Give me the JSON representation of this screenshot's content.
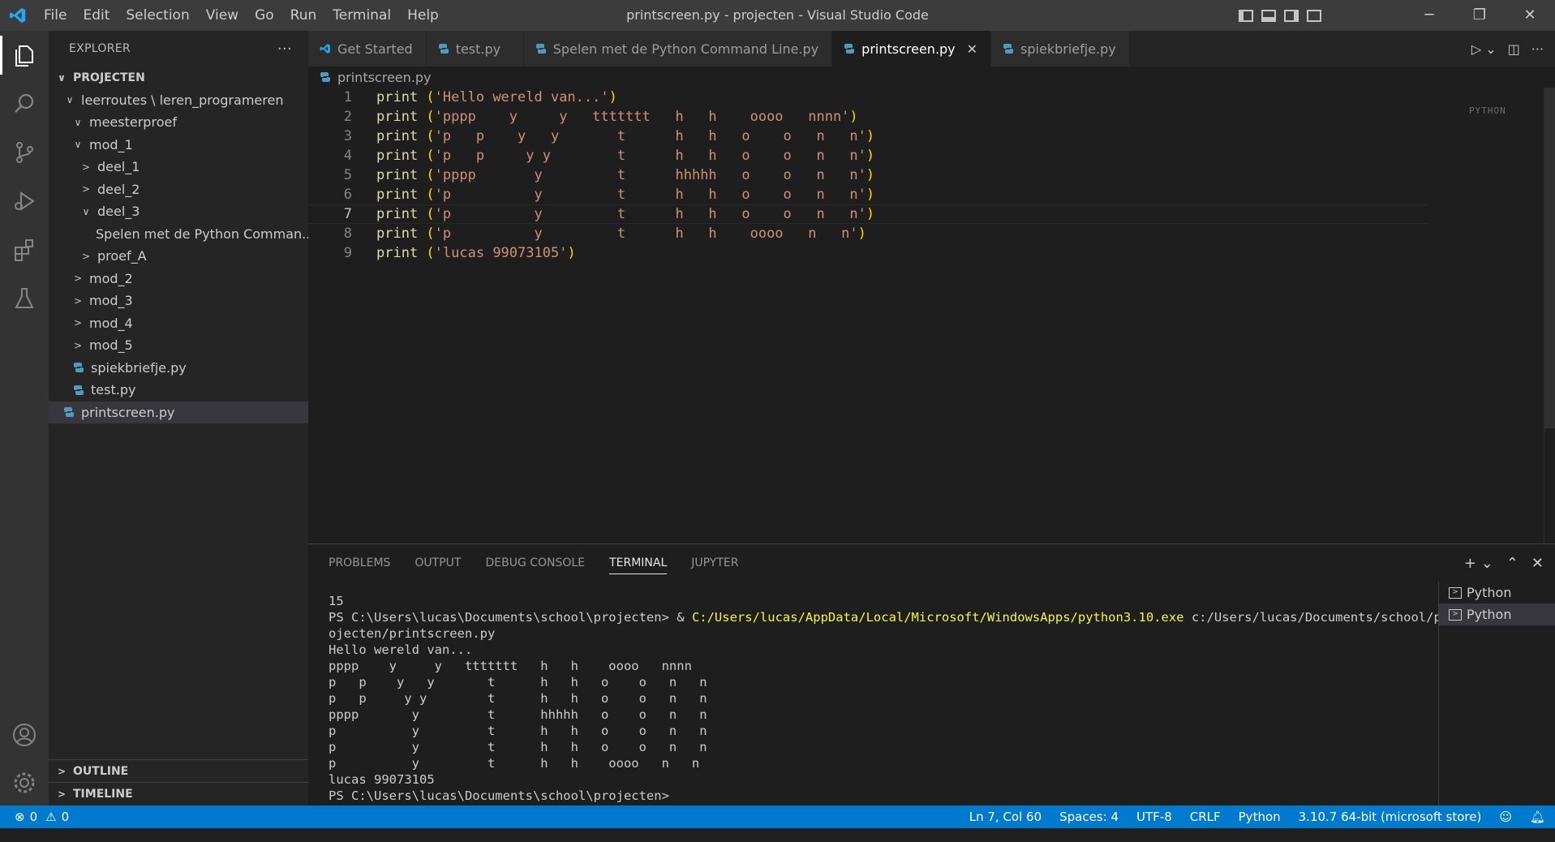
{
  "window": {
    "title": "printscreen.py - projecten - Visual Studio Code",
    "menu": [
      "File",
      "Edit",
      "Selection",
      "View",
      "Go",
      "Run",
      "Terminal",
      "Help"
    ]
  },
  "activitybar": {
    "icons": [
      "explorer-icon",
      "search-icon",
      "source-control-icon",
      "run-debug-icon",
      "extensions-icon",
      "testing-icon",
      "account-icon",
      "settings-gear-icon"
    ]
  },
  "sidebar": {
    "title": "EXPLORER",
    "more": "···",
    "tree": [
      {
        "label": "PROJECTEN",
        "chev": "∨",
        "depth": 0,
        "kind": "section"
      },
      {
        "label": "leerroutes \\ leren_programeren",
        "chev": "∨",
        "depth": 1,
        "kind": "folder"
      },
      {
        "label": "meesterproef",
        "chev": "∨",
        "depth": 2,
        "kind": "folder"
      },
      {
        "label": "mod_1",
        "chev": "∨",
        "depth": 2,
        "kind": "folder"
      },
      {
        "label": "deel_1",
        "chev": ">",
        "depth": 3,
        "kind": "folder"
      },
      {
        "label": "deel_2",
        "chev": ">",
        "depth": 3,
        "kind": "folder"
      },
      {
        "label": "deel_3",
        "chev": "∨",
        "depth": 3,
        "kind": "folder"
      },
      {
        "label": "Spelen met de Python Comman...",
        "chev": "",
        "depth": 4,
        "kind": "py"
      },
      {
        "label": "proef_A",
        "chev": ">",
        "depth": 3,
        "kind": "folder"
      },
      {
        "label": "mod_2",
        "chev": ">",
        "depth": 2,
        "kind": "folder"
      },
      {
        "label": "mod_3",
        "chev": ">",
        "depth": 2,
        "kind": "folder"
      },
      {
        "label": "mod_4",
        "chev": ">",
        "depth": 2,
        "kind": "folder"
      },
      {
        "label": "mod_5",
        "chev": ">",
        "depth": 2,
        "kind": "folder"
      },
      {
        "label": "spiekbriefje.py",
        "chev": "",
        "depth": 2,
        "kind": "py"
      },
      {
        "label": "test.py",
        "chev": "",
        "depth": 2,
        "kind": "py"
      },
      {
        "label": "printscreen.py",
        "chev": "",
        "depth": 1,
        "kind": "py",
        "selected": true
      }
    ],
    "outline": "OUTLINE",
    "timeline": "TIMELINE"
  },
  "tabs": [
    {
      "label": "Get Started",
      "icon": "vscode-icon",
      "active": false
    },
    {
      "label": "test.py",
      "icon": "python-icon",
      "active": false
    },
    {
      "label": "Spelen met de Python Command Line.py",
      "icon": "python-icon",
      "active": false
    },
    {
      "label": "printscreen.py",
      "icon": "python-icon",
      "active": true,
      "close": "✕"
    },
    {
      "label": "spiekbriefje.py",
      "icon": "python-icon",
      "active": false
    }
  ],
  "breadcrumb": "printscreen.py",
  "editor": {
    "current_line": 7,
    "lines": [
      {
        "n": "1",
        "fn": "print",
        "open": " (",
        "str": "'Hello wereld van...'",
        "close": ")"
      },
      {
        "n": "2",
        "fn": "print",
        "open": " (",
        "str": "'pppp    y     y   ttttttt   h   h    oooo   nnnn'",
        "close": ")"
      },
      {
        "n": "3",
        "fn": "print",
        "open": " (",
        "str": "'p   p    y   y       t      h   h   o    o   n   n'",
        "close": ")"
      },
      {
        "n": "4",
        "fn": "print",
        "open": " (",
        "str": "'p   p     y y        t      h   h   o    o   n   n'",
        "close": ")"
      },
      {
        "n": "5",
        "fn": "print",
        "open": " (",
        "str": "'pppp       y         t      hhhhh   o    o   n   n'",
        "close": ")"
      },
      {
        "n": "6",
        "fn": "print",
        "open": " (",
        "str": "'p          y         t      h   h   o    o   n   n'",
        "close": ")"
      },
      {
        "n": "7",
        "fn": "print",
        "open": " (",
        "str": "'p          y         t      h   h   o    o   n   n'",
        "close": ")"
      },
      {
        "n": "8",
        "fn": "print",
        "open": " (",
        "str": "'p          y         t      h   h    oooo   n   n'",
        "close": ")"
      },
      {
        "n": "9",
        "fn": "print",
        "open": " (",
        "str": "'lucas 99073105'",
        "close": ")"
      }
    ],
    "minimap_text": "PYTHON"
  },
  "panel": {
    "tabs": [
      "PROBLEMS",
      "OUTPUT",
      "DEBUG CONSOLE",
      "TERMINAL",
      "JUPYTER"
    ],
    "active_tab": "TERMINAL",
    "terminal_lines": [
      {
        "text": "15"
      },
      {
        "text": "PS C:\\Users\\lucas\\Documents\\school\\projecten> & ",
        "yellow": "C:/Users/lucas/AppData/Local/Microsoft/WindowsApps/python3.10.exe",
        "rest": " c:/Users/lucas/Documents/school/pr"
      },
      {
        "text": "ojecten/printscreen.py"
      },
      {
        "text": "Hello wereld van..."
      },
      {
        "text": "pppp    y     y   ttttttt   h   h    oooo   nnnn"
      },
      {
        "text": "p   p    y   y       t      h   h   o    o   n   n"
      },
      {
        "text": "p   p     y y        t      h   h   o    o   n   n"
      },
      {
        "text": "pppp       y         t      hhhhh   o    o   n   n"
      },
      {
        "text": "p          y         t      h   h   o    o   n   n"
      },
      {
        "text": "p          y         t      h   h   o    o   n   n"
      },
      {
        "text": "p          y         t      h   h    oooo   n   n"
      },
      {
        "text": "lucas 99073105"
      },
      {
        "text": "PS C:\\Users\\lucas\\Documents\\school\\projecten>"
      }
    ],
    "terminals": [
      "Python",
      "Python"
    ]
  },
  "statusbar": {
    "errors": "0",
    "warnings": "0",
    "position": "Ln 7, Col 60",
    "spaces": "Spaces: 4",
    "encoding": "UTF-8",
    "eol": "CRLF",
    "language": "Python",
    "interpreter": "3.10.7 64-bit (microsoft store)"
  },
  "colors": {
    "accent": "#007acc",
    "python_icon": "#519aba",
    "string": "#ce9178",
    "function": "#dcdcaa",
    "paren": "#ffd700"
  }
}
